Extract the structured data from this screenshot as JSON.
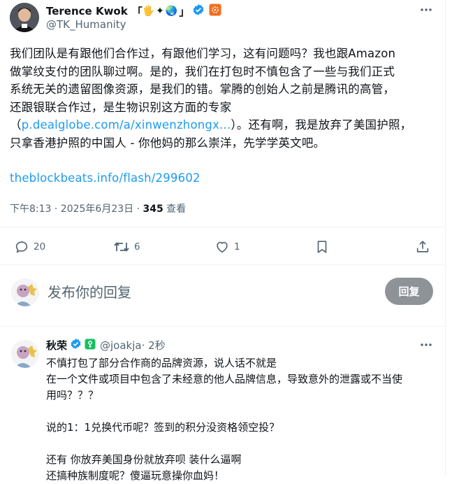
{
  "tweet": {
    "author_name": "Terence Kwok",
    "name_decor_open": "「",
    "name_emoji": "🖐✦🌏",
    "name_decor_close": "」",
    "author_handle": "@TK_Humanity",
    "body_lines": [
      "我们团队是有跟他们合作过，有跟他们学习，这有问题吗？我也跟Amazon",
      "做掌纹支付的团队聊过啊。是的，我们在打包时不慎包含了一些与我们正式",
      "系统无关的遗留图像资源，是我们的错。掌腾的创始人之前是腾讯的高管，",
      "还跟银联合作过，是生物识别这方面的专家"
    ],
    "paren_open": "（",
    "inline_link": "p.dealglobe.com/a/xinwenzhongx...",
    "after_link": "）。还有啊，我是放弃了美国护照，",
    "body_tail": "只拿香港护照的中国人 - 你他妈的那么崇洋，先学学英文吧。",
    "link": "theblockbeats.info/flash/299602",
    "time": "下午8:13 · 2025年6月23日 · ",
    "views_count": "345",
    "views_label": " 查看",
    "replies": "20",
    "retweets": "6",
    "likes": "1"
  },
  "reply_box": {
    "placeholder": "发布你的回复",
    "button": "回复"
  },
  "reply": {
    "author_name": "秋荣",
    "author_handle": "@joakja",
    "time": " · 2秒",
    "lines": [
      "不慎打包了部分合作商的品牌资源，说人话不就是",
      "在一个文件或项目中包含了未经意的他人品牌信息，导致意外的泄露或不当使",
      "用吗？？？",
      "",
      "说的1：1兑换代币呢？签到的积分没资格领空投？",
      "",
      "还有 你放弃美国身份就放弃呗 装什么逼啊",
      "还搞种族制度呢？傻逼玩意操你血妈！"
    ]
  },
  "colors": {
    "accent": "#1d9bf0",
    "secondary_text": "#536471",
    "verified": "#1d9bf0",
    "affiliate_badge": "#f26f21",
    "subscriber_badge": "#17bf63",
    "reply_button": "#8e9398"
  },
  "icons": [
    "more-icon",
    "verified-icon",
    "affiliate-badge-icon",
    "reply-icon",
    "retweet-icon",
    "like-icon",
    "bookmark-icon",
    "share-icon",
    "subscriber-badge-icon"
  ]
}
